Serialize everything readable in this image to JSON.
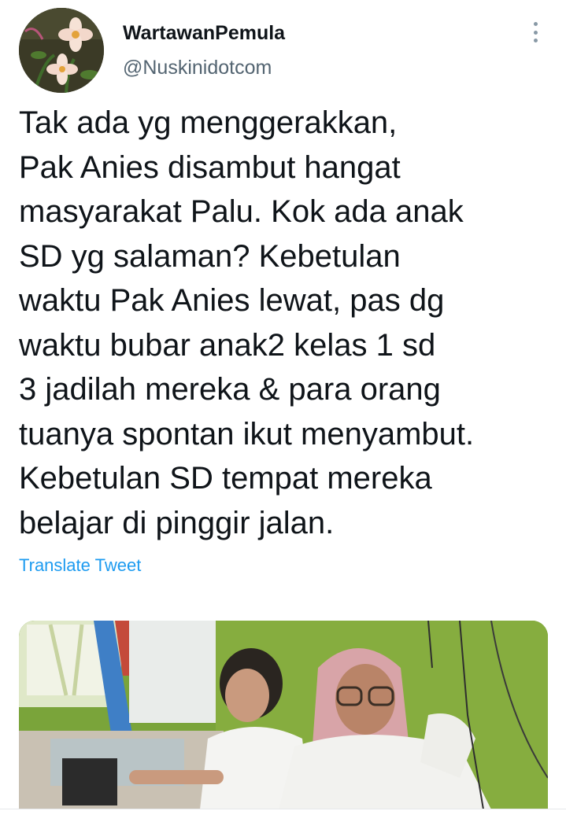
{
  "tweet": {
    "display_name": "WartawanPemula",
    "handle": "@Nuskinidotcom",
    "text": "Tak ada yg menggerakkan,\nPak Anies disambut hangat\nmasyarakat Palu. Kok ada anak\nSD yg salaman? Kebetulan\nwaktu Pak Anies lewat, pas dg\nwaktu bubar anak2 kelas 1 sd\n3 jadilah mereka & para orang\ntuanya spontan ikut menyambut.\nKebetulan SD tempat mereka\nbelajar di pinggir jalan.",
    "translate_label": "Translate Tweet",
    "more_icon": "more-vertical-icon"
  },
  "colors": {
    "text_primary": "#0f1419",
    "text_secondary": "#536471",
    "link": "#1d9bf0"
  }
}
